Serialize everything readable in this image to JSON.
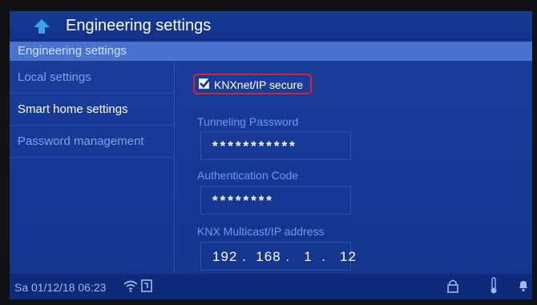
{
  "window": {
    "title": "Engineering settings"
  },
  "subheader": {
    "label": "Engineering settings"
  },
  "sidebar": {
    "items": [
      {
        "label": "Local settings",
        "color": "#7aa3ea"
      },
      {
        "label": "Smart home settings",
        "color": "#ffffff"
      },
      {
        "label": "Password management",
        "color": "#7aa3ea"
      }
    ]
  },
  "content": {
    "knxnet_secure": {
      "label": "KNXnet/IP secure",
      "checked": true
    },
    "tunneling_password": {
      "label": "Tunneling Password",
      "value": "***********"
    },
    "authentication_code": {
      "label": "Authentication Code",
      "value": "********"
    },
    "multicast_address": {
      "label": "KNX Multicast/IP address",
      "value": "192 .  168 .   1  .   12"
    }
  },
  "statusbar": {
    "datetime": "Sa 01/12/18  06:23",
    "icons": [
      "wifi-icon",
      "screen-icon",
      "lock-icon",
      "thermometer-icon",
      "bell-icon"
    ]
  },
  "colors": {
    "accent": "#4a73cf",
    "highlight_border": "#e02020",
    "label_blue": "#6e9be6"
  }
}
